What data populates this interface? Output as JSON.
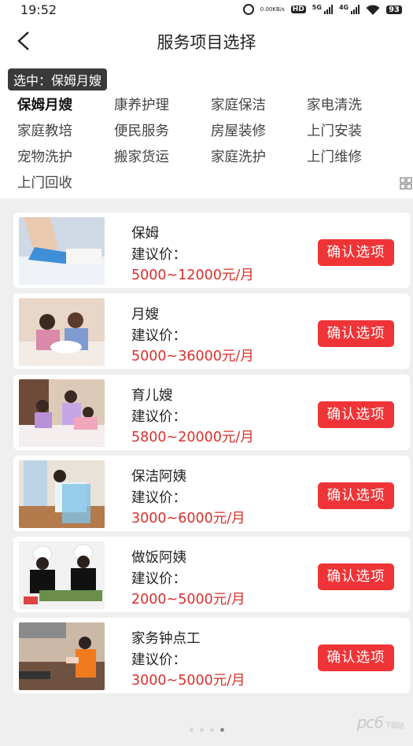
{
  "status_bar": {
    "time": "19:52",
    "net_speed_value": "0.00",
    "net_speed_unit": "KB/s",
    "hd_label": "HD",
    "network_1": "5G",
    "network_2": "4G",
    "battery": "93"
  },
  "header": {
    "title": "服务项目选择"
  },
  "selected": {
    "text": "选中：保姆月嫂"
  },
  "categories": [
    {
      "label": "保姆月嫂",
      "active": true
    },
    {
      "label": "康养护理"
    },
    {
      "label": "家庭保洁"
    },
    {
      "label": "家电清洗"
    },
    {
      "label": "家庭教培"
    },
    {
      "label": "便民服务"
    },
    {
      "label": "房屋装修"
    },
    {
      "label": "上门安装"
    },
    {
      "label": "宠物洗护"
    },
    {
      "label": "搬家货运"
    },
    {
      "label": "家庭洗护"
    },
    {
      "label": "上门维修"
    },
    {
      "label": "上门回收"
    }
  ],
  "services": [
    {
      "name": "保姆",
      "price_label": "建议价：",
      "price": "5000~12000元/月",
      "button": "确认选项"
    },
    {
      "name": "月嫂",
      "price_label": "建议价：",
      "price": "5000~36000元/月",
      "button": "确认选项"
    },
    {
      "name": "育儿嫂",
      "price_label": "建议价：",
      "price": "5800~20000元/月",
      "button": "确认选项"
    },
    {
      "name": "保洁阿姨",
      "price_label": "建议价：",
      "price": "3000~6000元/月",
      "button": "确认选项"
    },
    {
      "name": "做饭阿姨",
      "price_label": "建议价：",
      "price": "2000~5000元/月",
      "button": "确认选项"
    },
    {
      "name": "家务钟点工",
      "price_label": "建议价：",
      "price": "3000~5000元/月",
      "button": "确认选项"
    }
  ],
  "watermark": {
    "text": "pc6",
    "sub": "下载站"
  },
  "colors": {
    "accent": "#ef3437",
    "price": "#d9302c",
    "tag_bg": "#3a3a3a"
  }
}
